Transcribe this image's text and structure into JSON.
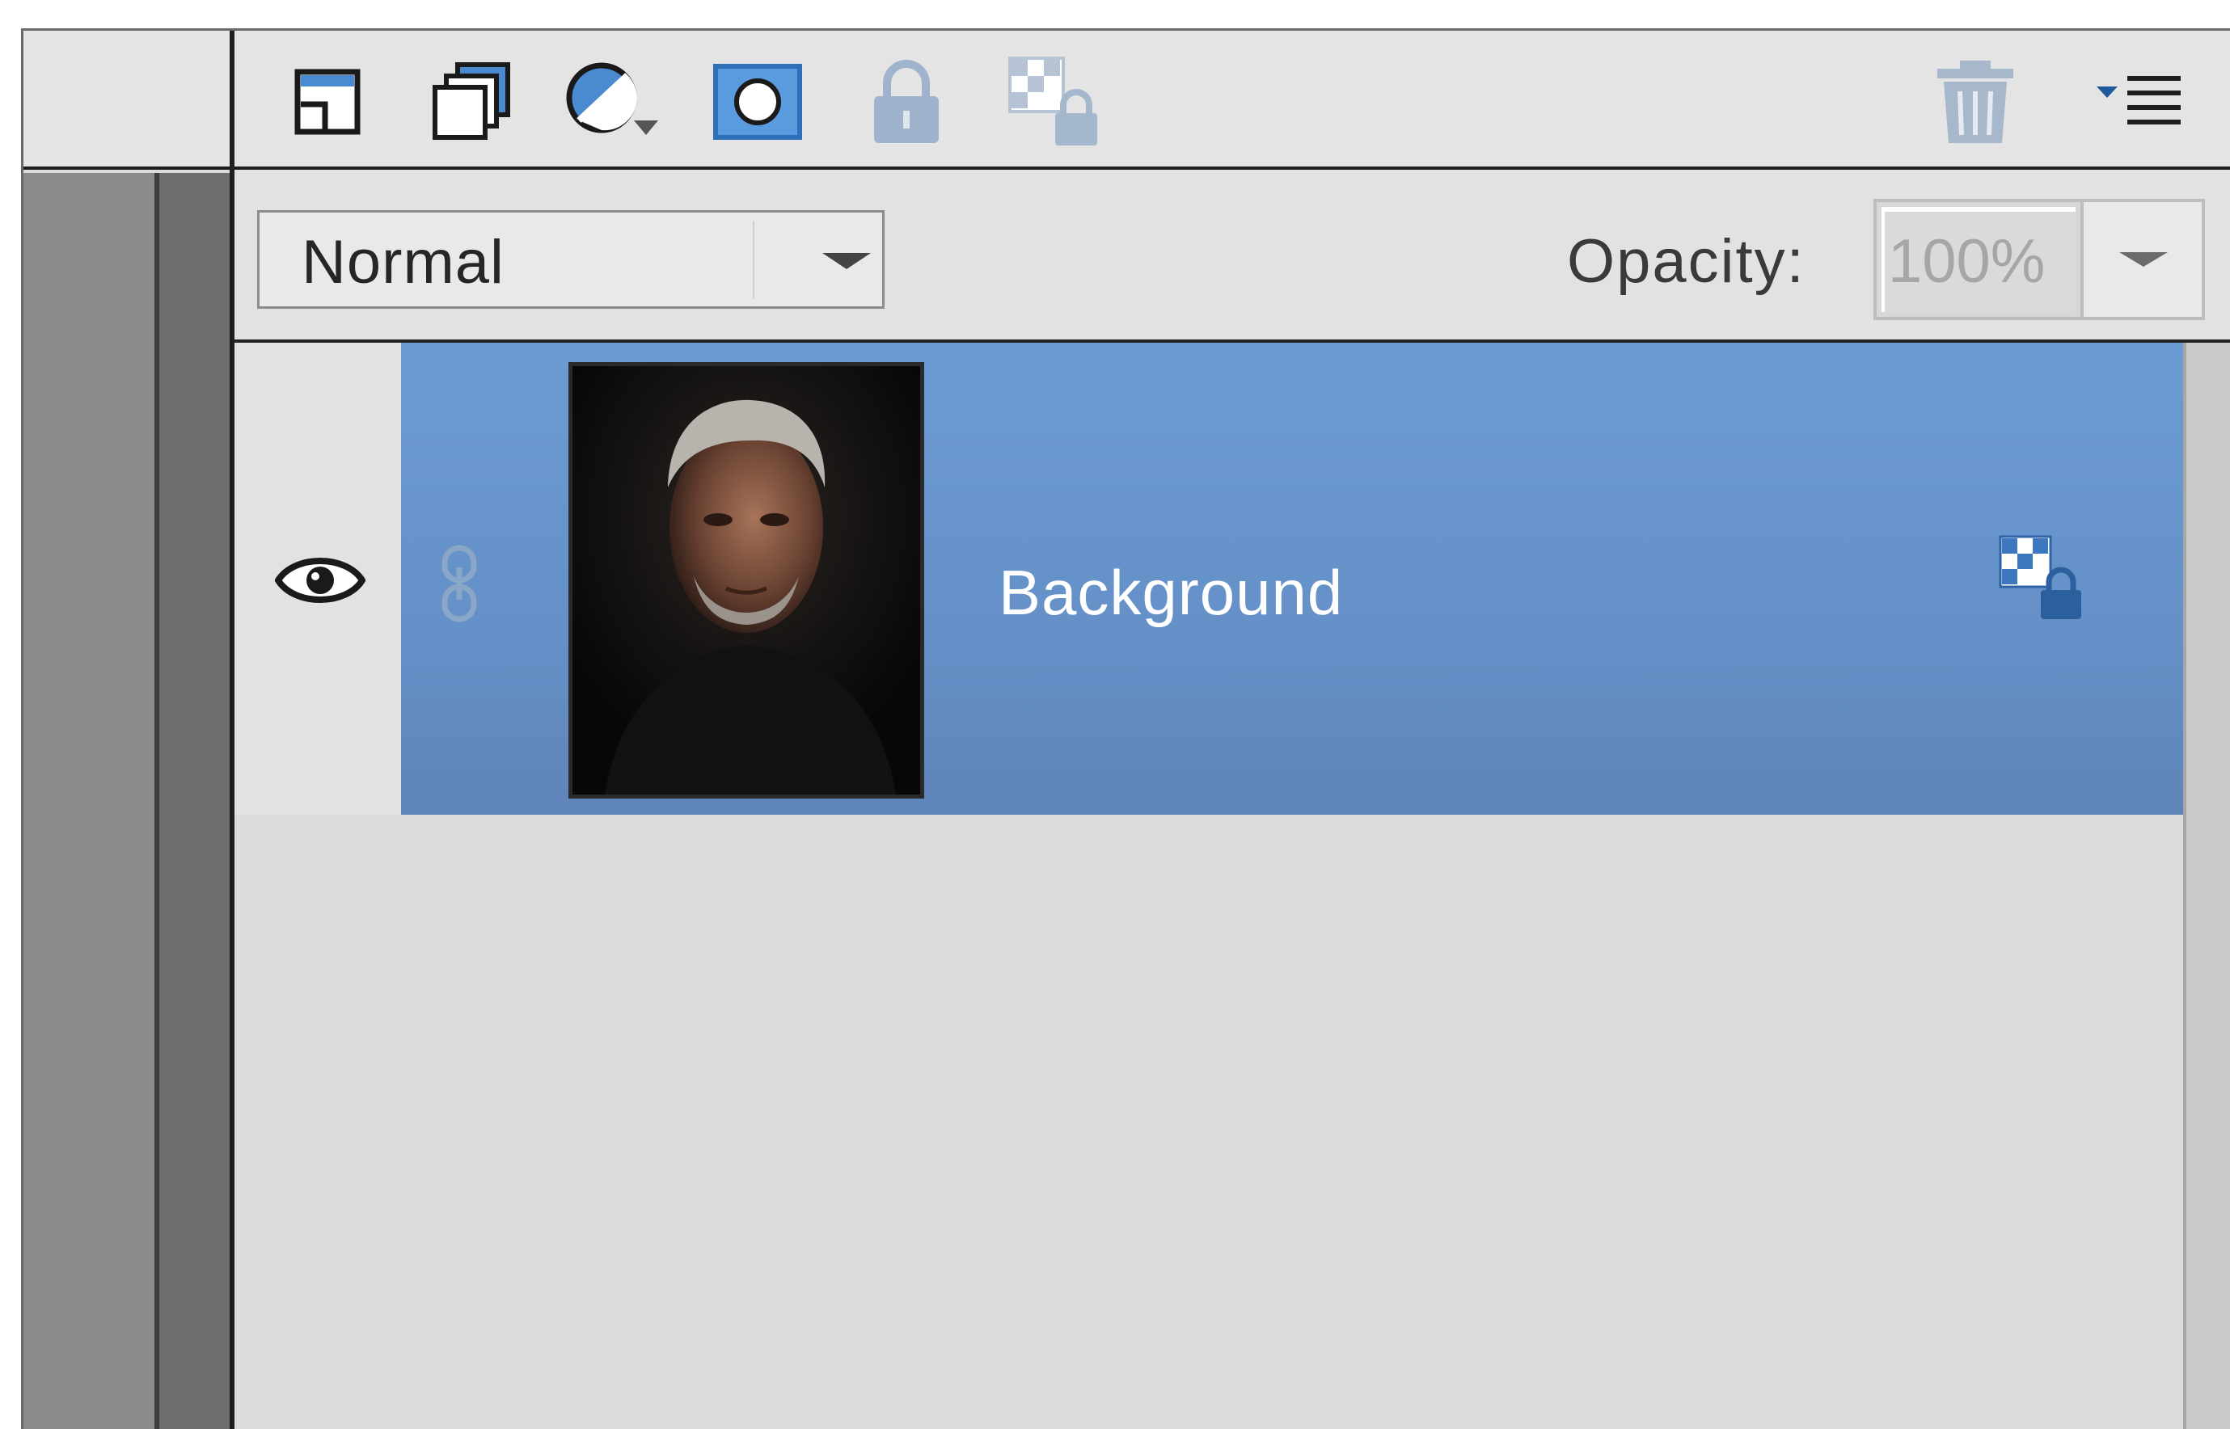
{
  "toolbar": {
    "tools": [
      {
        "name": "new-layer-icon"
      },
      {
        "name": "new-group-icon"
      },
      {
        "name": "adjustment-layer-icon"
      },
      {
        "name": "layer-mask-icon"
      },
      {
        "name": "lock-all-icon"
      },
      {
        "name": "lock-transparent-pixels-icon"
      }
    ],
    "delete_icon": "trash-icon",
    "menu_icon": "panel-menu-icon"
  },
  "blend": {
    "mode": "Normal",
    "opacity_label": "Opacity:",
    "opacity_value": "100%"
  },
  "layers": [
    {
      "name": "Background",
      "visible": true,
      "selected": true,
      "locked_transparency": true
    }
  ],
  "colors": {
    "selection": "#6590c8",
    "panel_bg": "#dddddf",
    "toolbar_icon": "#3f7fc4"
  }
}
